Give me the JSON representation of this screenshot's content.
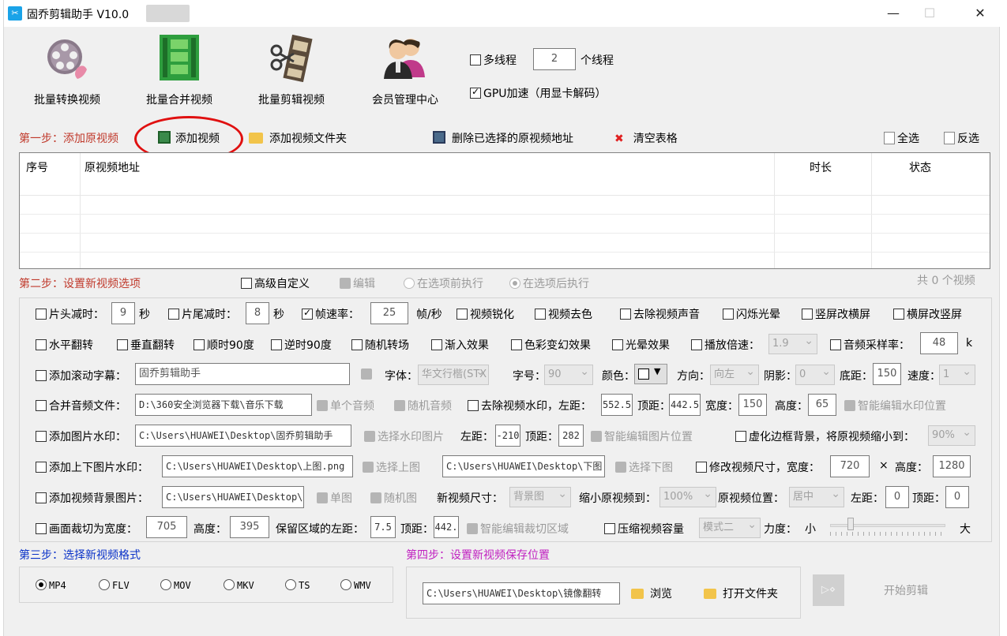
{
  "window": {
    "title": "固乔剪辑助手 V10.0",
    "minimize": "—",
    "maximize": "☐",
    "close": "✕"
  },
  "toolbar": {
    "batch_convert": "批量转换视频",
    "batch_merge": "批量合并视频",
    "batch_edit": "批量剪辑视频",
    "member_center": "会员管理中心",
    "multithread_label": "多线程",
    "thread_count": "2",
    "thread_unit": "个线程",
    "gpu_label": "GPU加速（用显卡解码）"
  },
  "step1": {
    "label": "第一步：添加原视频",
    "add_video": "添加视频",
    "add_folder": "添加视频文件夹",
    "delete_selected": "删除已选择的原视频地址",
    "clear_table": "清空表格",
    "select_all": "全选",
    "invert": "反选"
  },
  "table": {
    "col_index": "序号",
    "col_path": "原视频地址",
    "col_duration": "时长",
    "col_status": "状态"
  },
  "step2": {
    "label": "第二步：设置新视频选项",
    "advanced": "高级自定义",
    "edit": "编辑",
    "before": "在选项前执行",
    "after": "在选项后执行",
    "count_text": "共 0 个视频"
  },
  "opts": {
    "head_cut": "片头减时：",
    "head_val": "9",
    "sec1": "秒",
    "tail_cut": "片尾减时：",
    "tail_val": "8",
    "sec2": "秒",
    "fps": "帧速率：",
    "fps_val": "25",
    "fps_unit": "帧/秒",
    "sharpen": "视频锐化",
    "decolor": "视频去色",
    "remove_audio": "去除视频声音",
    "flash": "闪烁光晕",
    "v2h": "竖屏改横屏",
    "h2v": "横屏改竖屏",
    "hflip": "水平翻转",
    "vflip": "垂直翻转",
    "cw90": "顺时90度",
    "ccw90": "逆时90度",
    "random_trans": "随机转场",
    "fade_in": "渐入效果",
    "color_shift": "色彩变幻效果",
    "halo": "光晕效果",
    "speed": "播放倍速：",
    "speed_val": "1.9",
    "sample_rate": "音频采样率：",
    "sample_val": "48",
    "sample_unit": "k",
    "subtitle": "添加滚动字幕：",
    "subtitle_val": "固乔剪辑助手",
    "font": "字体：",
    "font_val": "华文行楷(STX",
    "size": "字号：",
    "size_val": "90",
    "color": "颜色：",
    "direction": "方向：",
    "direction_val": "向左",
    "shadow": "阴影：",
    "shadow_val": "0",
    "bottom": "底距：",
    "bottom_val": "150",
    "speed2": "速度：",
    "speed2_val": "1",
    "merge_audio": "合并音频文件：",
    "audio_path": "D:\\360安全浏览器下载\\音乐下载",
    "single_audio": "单个音频",
    "random_audio": "随机音频",
    "remove_wm": "去除视频水印，左距：",
    "wm_left": "552.5",
    "wm_top_lbl": "顶距：",
    "wm_top": "442.5",
    "wm_w_lbl": "宽度：",
    "wm_w": "150",
    "wm_h_lbl": "高度：",
    "wm_h": "65",
    "smart_wm": "智能编辑水印位置",
    "img_wm": "添加图片水印：",
    "img_wm_path": "C:\\Users\\HUAWEI\\Desktop\\固乔剪辑助手",
    "choose_wm": "选择水印图片",
    "img_left_lbl": "左距：",
    "img_left": "-210",
    "img_top_lbl": "顶距：",
    "img_top": "282",
    "smart_img": "智能编辑图片位置",
    "blur_bg": "虚化边框背景，将原视频缩小到：",
    "blur_val": "90%",
    "tb_wm": "添加上下图片水印：",
    "top_img": "C:\\Users\\HUAWEI\\Desktop\\上图.png",
    "choose_top": "选择上图",
    "bottom_img": "C:\\Users\\HUAWEI\\Desktop\\下图",
    "choose_bottom": "选择下图",
    "resize": "修改视频尺寸，宽度：",
    "resize_w": "720",
    "times": "×",
    "resize_h_lbl": "高度：",
    "resize_h": "1280",
    "bg_img": "添加视频背景图片：",
    "bg_path": "C:\\Users\\HUAWEI\\Desktop\\",
    "single_img": "单图",
    "random_img": "随机图",
    "new_size": "新视频尺寸：",
    "new_size_val": "背景图",
    "shrink": "缩小原视频到：",
    "shrink_val": "100%",
    "orig_pos": "原视频位置：",
    "orig_pos_val": "居中",
    "left_lbl": "左距：",
    "left_val": "0",
    "top_lbl": "顶距：",
    "top_val": "0",
    "crop": "画面裁切为宽度：",
    "crop_w": "705",
    "crop_h_lbl": "高度：",
    "crop_h": "395",
    "keep_left": "保留区域的左距：",
    "keep_left_val": "7.5",
    "keep_top_lbl": "顶距：",
    "keep_top_val": "442.",
    "smart_crop": "智能编辑裁切区域",
    "compress": "压缩视频容量",
    "compress_mode": "模式二",
    "strength": "力度：",
    "small": "小",
    "big": "大"
  },
  "step3": {
    "label": "第三步：选择新视频格式",
    "formats": [
      "MP4",
      "FLV",
      "MOV",
      "MKV",
      "TS",
      "WMV"
    ]
  },
  "step4": {
    "label": "第四步：设置新视频保存位置",
    "path": "C:\\Users\\HUAWEI\\Desktop\\镜像翻转",
    "browse": "浏览",
    "open_folder": "打开文件夹",
    "start": "开始剪辑"
  }
}
